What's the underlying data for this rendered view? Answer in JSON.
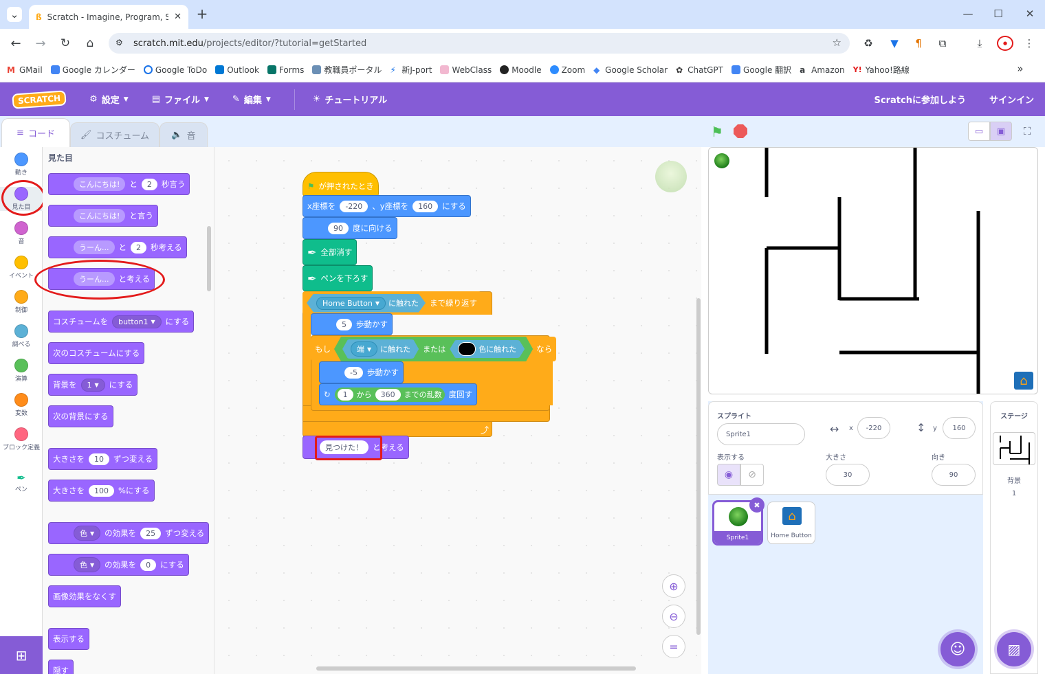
{
  "browser": {
    "tab_title": "Scratch - Imagine, Program, Sha",
    "url_host": "scratch.mit.edu",
    "url_path": "/projects/editor/?tutorial=getStarted",
    "bookmarks": [
      "GMail",
      "Google カレンダー",
      "Google ToDo",
      "Outlook",
      "Forms",
      "教職員ポータル",
      "新J-port",
      "WebClass",
      "Moodle",
      "Zoom",
      "Google Scholar",
      "ChatGPT",
      "Google 翻訳",
      "Amazon",
      "Yahoo!路線"
    ]
  },
  "menu": {
    "logo": "SCRATCH",
    "settings": "設定",
    "file": "ファイル",
    "edit": "編集",
    "tutorial": "チュートリアル",
    "join": "Scratchに参加しよう",
    "signin": "サインイン"
  },
  "tabs": {
    "code": "コード",
    "costume": "コスチューム",
    "sound": "音"
  },
  "categories": [
    "動き",
    "見た目",
    "音",
    "イベント",
    "制御",
    "調べる",
    "演算",
    "変数",
    "ブロック定義",
    "ペン"
  ],
  "palette": {
    "heading": "見た目",
    "say_secs": {
      "text": "こんにちは!",
      "mid": "と",
      "n": "2",
      "end": "秒言う"
    },
    "say": {
      "text": "こんにちは!",
      "end": "と言う"
    },
    "think_secs": {
      "text": "うーん...",
      "mid": "と",
      "n": "2",
      "end": "秒考える"
    },
    "think": {
      "text": "うーん...",
      "end": "と考える"
    },
    "costume_to": {
      "pre": "コスチュームを",
      "val": "button1",
      "end": "にする"
    },
    "next_costume": "次のコスチュームにする",
    "backdrop_to": {
      "pre": "背景を",
      "val": "1",
      "end": "にする"
    },
    "next_backdrop": "次の背景にする",
    "size_change": {
      "pre": "大きさを",
      "val": "10",
      "end": "ずつ変える"
    },
    "size_set": {
      "pre": "大きさを",
      "val": "100",
      "end": "%にする"
    },
    "effect_change": {
      "val": "色",
      "mid": "の効果を",
      "n": "25",
      "end": "ずつ変える"
    },
    "effect_set": {
      "val": "色",
      "mid": "の効果を",
      "n": "0",
      "end": "にする"
    },
    "clear_effects": "画像効果をなくす",
    "show": "表示する",
    "hide": "隠す"
  },
  "script": {
    "flag_hat": "が押されたとき",
    "goto": {
      "pre": "x座標を",
      "x": "-220",
      "mid": "、y座標を",
      "y": "160",
      "end": "にする"
    },
    "point": {
      "val": "90",
      "end": "度に向ける"
    },
    "erase": "全部消す",
    "pen_down": "ペンを下ろす",
    "repeat_until": {
      "sensor": "Home Button",
      "touch": "に触れた",
      "end": "まで繰り返す"
    },
    "move1": {
      "val": "5",
      "end": "歩動かす"
    },
    "if": {
      "pre": "もし",
      "edge": "端",
      "touch": "に触れた",
      "or": "または",
      "color_touch": "色に触れた",
      "then": "なら"
    },
    "move2": {
      "val": "-5",
      "end": "歩動かす"
    },
    "turn": {
      "from": "1",
      "kara": "から",
      "to": "360",
      "rand": "までの乱数",
      "end": "度回す"
    },
    "think": {
      "val": "見つけた！",
      "end": "と考える"
    }
  },
  "sprite_info": {
    "label": "スプライト",
    "name": "Sprite1",
    "x": "-220",
    "y": "160",
    "show_label": "表示する",
    "size_label": "大きさ",
    "size": "30",
    "dir_label": "向き",
    "dir": "90"
  },
  "sprites": [
    {
      "name": "Sprite1",
      "selected": true
    },
    {
      "name": "Home Button",
      "selected": false
    }
  ],
  "stage_pane": {
    "label": "ステージ",
    "bg_label": "背景",
    "bg_count": "1"
  },
  "colors": {
    "scratch_purple": "#855cd6",
    "looks": "#9966ff",
    "control": "#ffab19",
    "motion": "#4c97ff",
    "pen": "#0fbd8c",
    "operators": "#59c059",
    "sensing": "#5cb1d6",
    "events": "#ffbf00",
    "annotation": "#e31b1b"
  }
}
